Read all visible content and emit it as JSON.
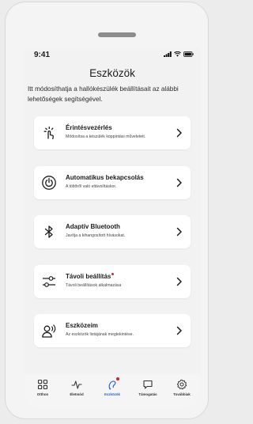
{
  "status": {
    "time": "9:41"
  },
  "header": {
    "title": "Eszközök"
  },
  "intro": "Itt módosíthatja a hallókészülék beállításait az alábbi lehetőségek segítségével.",
  "items": [
    {
      "title": "Érintésvezérlés",
      "subtitle": "Módosítsa a készülék koppintási műveleteit.",
      "icon": "touch-icon",
      "badge": false
    },
    {
      "title": "Automatikus bekapcsolás",
      "subtitle": "A töltőről való eltávolításkor.",
      "icon": "power-icon",
      "badge": false
    },
    {
      "title": "Adaptív Bluetooth",
      "subtitle": "Javítja a kihangosított hívásokat.",
      "icon": "bluetooth-icon",
      "badge": false
    },
    {
      "title": "Távoli beállítás",
      "subtitle": "Távoli beállítások alkalmazása",
      "icon": "sliders-icon",
      "badge": true
    },
    {
      "title": "Eszközeim",
      "subtitle": "Az eszközök listájának megtekintése.",
      "icon": "person-sound-icon",
      "badge": false
    }
  ],
  "tabs": [
    {
      "label": "Otthon",
      "icon": "grid-icon",
      "active": false,
      "badge": false
    },
    {
      "label": "Életmód",
      "icon": "activity-icon",
      "active": false,
      "badge": false
    },
    {
      "label": "Eszközök",
      "icon": "hearing-aid-icon",
      "active": true,
      "badge": true
    },
    {
      "label": "Támogatás",
      "icon": "chat-icon",
      "active": false,
      "badge": false
    },
    {
      "label": "Továbbiak",
      "icon": "gear-icon",
      "active": false,
      "badge": false
    }
  ],
  "colors": {
    "accent": "#2f5fe0",
    "badge": "#d6202a"
  }
}
